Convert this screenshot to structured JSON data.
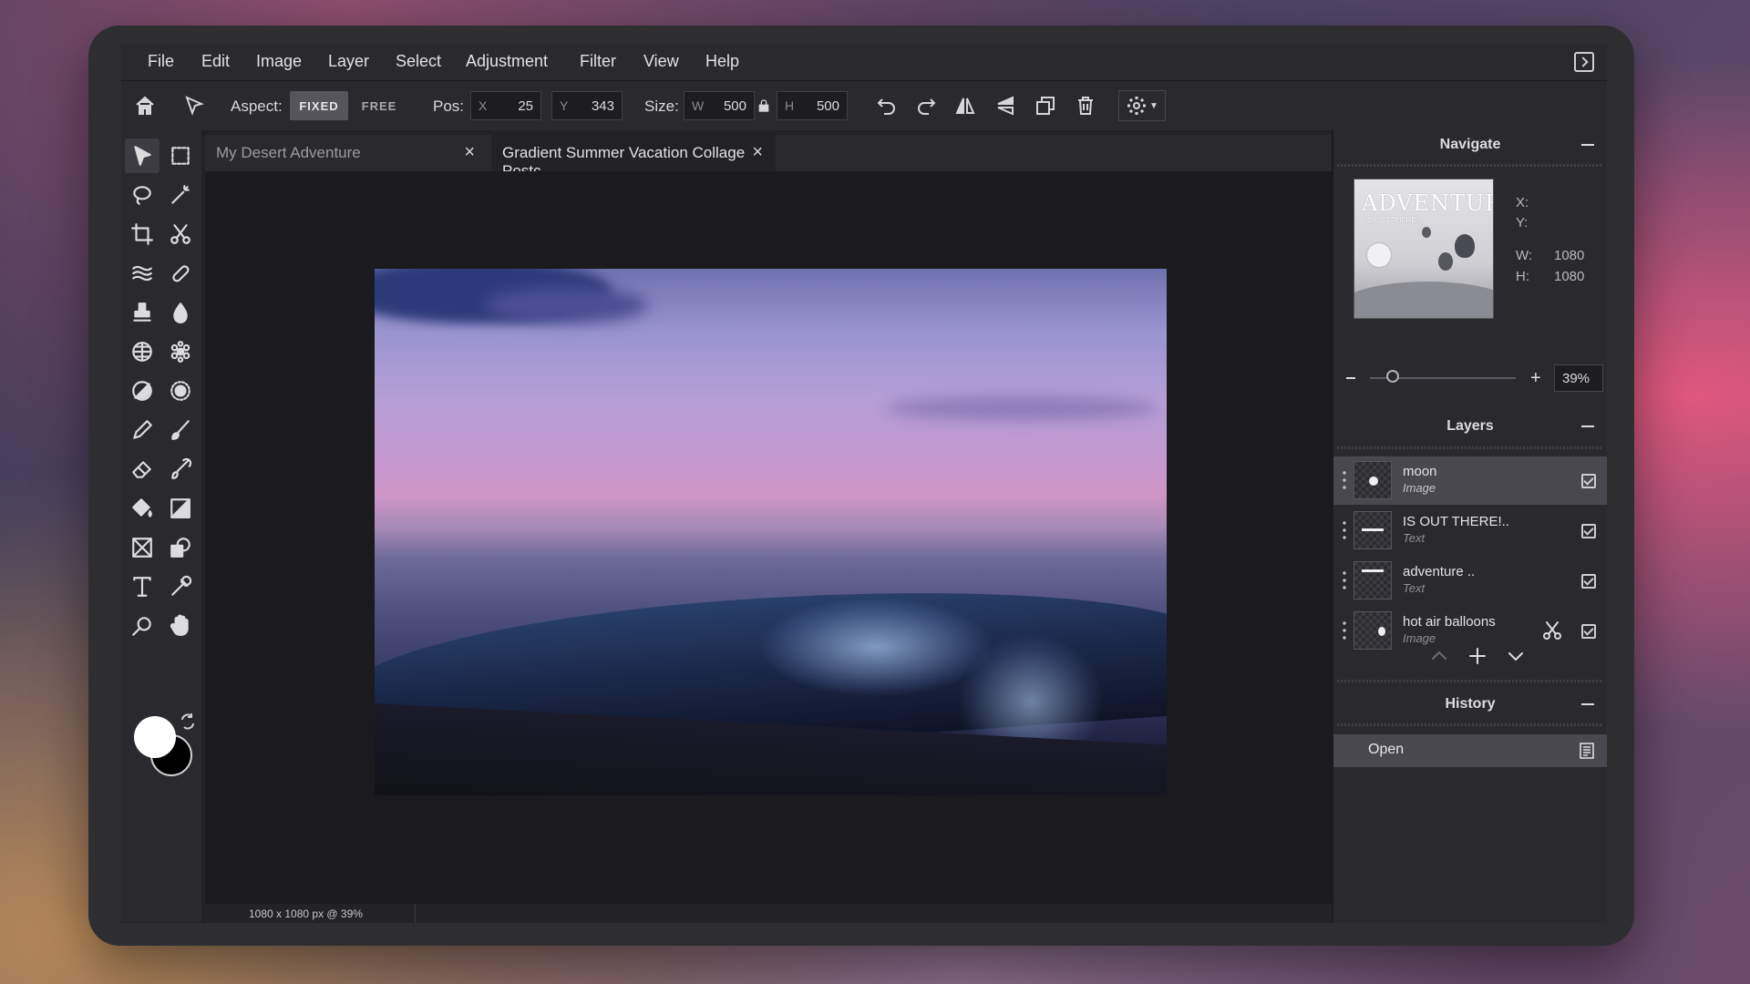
{
  "menu": [
    "File",
    "Edit",
    "Image",
    "Layer",
    "Select",
    "Adjustment",
    "Filter",
    "View",
    "Help"
  ],
  "options": {
    "aspect_label": "Aspect:",
    "aspect_fixed": "FIXED",
    "aspect_free": "FREE",
    "pos_label": "Pos:",
    "x_prefix": "X",
    "x_value": "25",
    "y_prefix": "Y",
    "y_value": "343",
    "size_label": "Size:",
    "w_prefix": "W",
    "w_value": "500",
    "h_prefix": "H",
    "h_value": "500",
    "icons": [
      "home-icon",
      "pointer-icon",
      "lock-icon",
      "undo-icon",
      "redo-icon",
      "flip-horizontal-icon",
      "flip-vertical-icon",
      "duplicate-icon",
      "trash-icon",
      "gear-icon"
    ]
  },
  "tabs": [
    {
      "label": "My Desert Adventure",
      "active": false
    },
    {
      "label": "Gradient Summer Vacation Collage Postc...",
      "active": true
    }
  ],
  "tools": [
    "move-tool-icon",
    "marquee-tool-icon",
    "lasso-tool-icon",
    "magic-wand-tool-icon",
    "crop-tool-icon",
    "scissors-tool-icon",
    "liquify-tool-icon",
    "heal-tool-icon",
    "stamp-tool-icon",
    "blur-tool-icon",
    "sponge-tool-icon",
    "bloat-tool-icon",
    "dodge-tool-icon",
    "pinch-tool-icon",
    "pencil-tool-icon",
    "brush-tool-icon",
    "eraser-tool-icon",
    "color-replace-tool-icon",
    "fill-tool-icon",
    "gradient-tool-icon",
    "frame-tool-icon",
    "shape-tool-icon",
    "text-tool-icon",
    "eyedropper-tool-icon",
    "zoom-tool-icon",
    "hand-tool-icon"
  ],
  "colors": {
    "foreground": "#ffffff",
    "background": "#000000"
  },
  "status": {
    "text": "1080 x 1080 px @ 39%"
  },
  "navigate": {
    "title": "Navigate",
    "x_label": "X:",
    "y_label": "Y:",
    "w_label": "W:",
    "w_value": "1080",
    "h_label": "H:",
    "h_value": "1080",
    "zoom_minus": "-",
    "zoom_plus": "+",
    "zoom_value": "39%",
    "thumb_title": "ADVENTURE",
    "thumb_subtitle": "IS OUT THERE!"
  },
  "layers": {
    "title": "Layers",
    "items": [
      {
        "name": "moon",
        "type": "Image",
        "selected": true
      },
      {
        "name": "IS OUT THERE!..",
        "type": "Text",
        "selected": false
      },
      {
        "name": "adventure ..",
        "type": "Text",
        "selected": false
      },
      {
        "name": "hot air balloons",
        "type": "Image",
        "selected": false
      }
    ]
  },
  "history": {
    "title": "History",
    "items": [
      "Open"
    ]
  }
}
